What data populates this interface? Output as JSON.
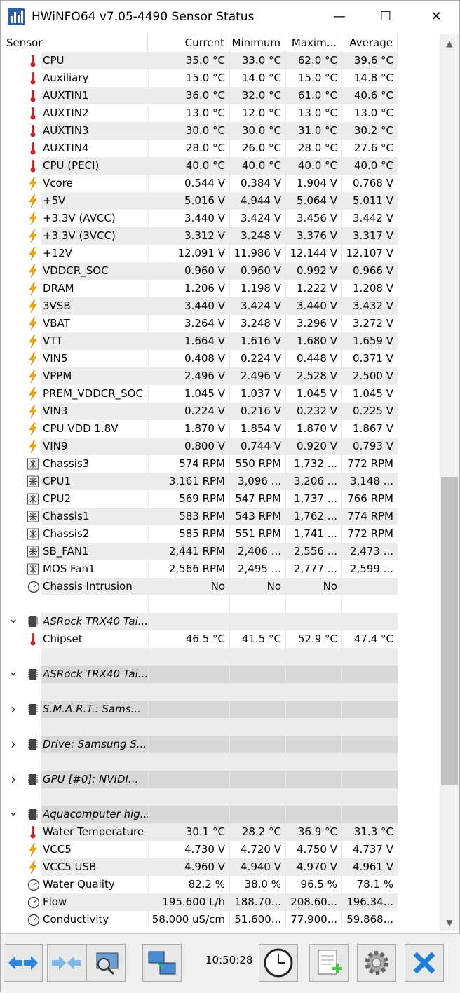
{
  "window": {
    "title": "HWiNFO64 v7.05-4490 Sensor Status",
    "minimize": "—",
    "maximize": "☐",
    "close": "✕"
  },
  "columns": [
    "Sensor",
    "Current",
    "Minimum",
    "Maxim...",
    "Average"
  ],
  "rows": [
    {
      "type": "sensor",
      "icon": "thermometer",
      "name": "CPU",
      "cur": "35.0 °C",
      "min": "33.0 °C",
      "max": "62.0 °C",
      "avg": "39.6 °C"
    },
    {
      "type": "sensor",
      "icon": "thermometer",
      "name": "Auxiliary",
      "cur": "15.0 °C",
      "min": "14.0 °C",
      "max": "15.0 °C",
      "avg": "14.8 °C"
    },
    {
      "type": "sensor",
      "icon": "thermometer",
      "name": "AUXTIN1",
      "cur": "36.0 °C",
      "min": "32.0 °C",
      "max": "61.0 °C",
      "avg": "40.6 °C"
    },
    {
      "type": "sensor",
      "icon": "thermometer",
      "name": "AUXTIN2",
      "cur": "13.0 °C",
      "min": "12.0 °C",
      "max": "13.0 °C",
      "avg": "13.0 °C"
    },
    {
      "type": "sensor",
      "icon": "thermometer",
      "name": "AUXTIN3",
      "cur": "30.0 °C",
      "min": "30.0 °C",
      "max": "31.0 °C",
      "avg": "30.2 °C"
    },
    {
      "type": "sensor",
      "icon": "thermometer",
      "name": "AUXTIN4",
      "cur": "28.0 °C",
      "min": "26.0 °C",
      "max": "28.0 °C",
      "avg": "27.6 °C"
    },
    {
      "type": "sensor",
      "icon": "thermometer",
      "name": "CPU (PECI)",
      "cur": "40.0 °C",
      "min": "40.0 °C",
      "max": "40.0 °C",
      "avg": "40.0 °C"
    },
    {
      "type": "sensor",
      "icon": "bolt",
      "name": "Vcore",
      "cur": "0.544 V",
      "min": "0.384 V",
      "max": "1.904 V",
      "avg": "0.768 V"
    },
    {
      "type": "sensor",
      "icon": "bolt",
      "name": "+5V",
      "cur": "5.016 V",
      "min": "4.944 V",
      "max": "5.064 V",
      "avg": "5.011 V"
    },
    {
      "type": "sensor",
      "icon": "bolt",
      "name": "+3.3V (AVCC)",
      "cur": "3.440 V",
      "min": "3.424 V",
      "max": "3.456 V",
      "avg": "3.442 V"
    },
    {
      "type": "sensor",
      "icon": "bolt",
      "name": "+3.3V (3VCC)",
      "cur": "3.312 V",
      "min": "3.248 V",
      "max": "3.376 V",
      "avg": "3.317 V"
    },
    {
      "type": "sensor",
      "icon": "bolt",
      "name": "+12V",
      "cur": "12.091 V",
      "min": "11.986 V",
      "max": "12.144 V",
      "avg": "12.107 V"
    },
    {
      "type": "sensor",
      "icon": "bolt",
      "name": "VDDCR_SOC",
      "cur": "0.960 V",
      "min": "0.960 V",
      "max": "0.992 V",
      "avg": "0.966 V"
    },
    {
      "type": "sensor",
      "icon": "bolt",
      "name": "DRAM",
      "cur": "1.206 V",
      "min": "1.198 V",
      "max": "1.222 V",
      "avg": "1.208 V"
    },
    {
      "type": "sensor",
      "icon": "bolt",
      "name": "3VSB",
      "cur": "3.440 V",
      "min": "3.424 V",
      "max": "3.440 V",
      "avg": "3.432 V"
    },
    {
      "type": "sensor",
      "icon": "bolt",
      "name": "VBAT",
      "cur": "3.264 V",
      "min": "3.248 V",
      "max": "3.296 V",
      "avg": "3.272 V"
    },
    {
      "type": "sensor",
      "icon": "bolt",
      "name": "VTT",
      "cur": "1.664 V",
      "min": "1.616 V",
      "max": "1.680 V",
      "avg": "1.659 V"
    },
    {
      "type": "sensor",
      "icon": "bolt",
      "name": "VIN5",
      "cur": "0.408 V",
      "min": "0.224 V",
      "max": "0.448 V",
      "avg": "0.371 V"
    },
    {
      "type": "sensor",
      "icon": "bolt",
      "name": "VPPM",
      "cur": "2.496 V",
      "min": "2.496 V",
      "max": "2.528 V",
      "avg": "2.500 V"
    },
    {
      "type": "sensor",
      "icon": "bolt",
      "name": "PREM_VDDCR_SOC",
      "cur": "1.045 V",
      "min": "1.037 V",
      "max": "1.045 V",
      "avg": "1.045 V"
    },
    {
      "type": "sensor",
      "icon": "bolt",
      "name": "VIN3",
      "cur": "0.224 V",
      "min": "0.216 V",
      "max": "0.232 V",
      "avg": "0.225 V"
    },
    {
      "type": "sensor",
      "icon": "bolt",
      "name": "CPU VDD 1.8V",
      "cur": "1.870 V",
      "min": "1.854 V",
      "max": "1.870 V",
      "avg": "1.867 V"
    },
    {
      "type": "sensor",
      "icon": "bolt",
      "name": "VIN9",
      "cur": "0.800 V",
      "min": "0.744 V",
      "max": "0.920 V",
      "avg": "0.793 V"
    },
    {
      "type": "sensor",
      "icon": "fan",
      "name": "Chassis3",
      "cur": "574 RPM",
      "min": "550 RPM",
      "max": "1,732 ...",
      "avg": "772 RPM"
    },
    {
      "type": "sensor",
      "icon": "fan",
      "name": "CPU1",
      "cur": "3,161 RPM",
      "min": "3,096 ...",
      "max": "3,206 ...",
      "avg": "3,148 ..."
    },
    {
      "type": "sensor",
      "icon": "fan",
      "name": "CPU2",
      "cur": "569 RPM",
      "min": "547 RPM",
      "max": "1,737 ...",
      "avg": "766 RPM"
    },
    {
      "type": "sensor",
      "icon": "fan",
      "name": "Chassis1",
      "cur": "583 RPM",
      "min": "543 RPM",
      "max": "1,762 ...",
      "avg": "774 RPM"
    },
    {
      "type": "sensor",
      "icon": "fan",
      "name": "Chassis2",
      "cur": "585 RPM",
      "min": "551 RPM",
      "max": "1,741 ...",
      "avg": "772 RPM"
    },
    {
      "type": "sensor",
      "icon": "fan",
      "name": "SB_FAN1",
      "cur": "2,441 RPM",
      "min": "2,406 ...",
      "max": "2,556 ...",
      "avg": "2,473 ..."
    },
    {
      "type": "sensor",
      "icon": "fan",
      "name": "MOS Fan1",
      "cur": "2,566 RPM",
      "min": "2,495 ...",
      "max": "2,777 ...",
      "avg": "2,599 ..."
    },
    {
      "type": "sensor",
      "icon": "gauge",
      "name": "Chassis Intrusion",
      "cur": "No",
      "min": "No",
      "max": "No",
      "avg": ""
    },
    {
      "type": "blank"
    },
    {
      "type": "group",
      "expanded": true,
      "name": "ASRock TRX40 Tai..."
    },
    {
      "type": "sensor",
      "icon": "thermometer",
      "name": "Chipset",
      "cur": "46.5 °C",
      "min": "41.5 °C",
      "max": "52.9 °C",
      "avg": "47.4 °C"
    },
    {
      "type": "blank"
    },
    {
      "type": "group",
      "expanded": true,
      "name": "ASRock TRX40 Tai..."
    },
    {
      "type": "blank"
    },
    {
      "type": "group",
      "expanded": false,
      "name": "S.M.A.R.T.: Sams..."
    },
    {
      "type": "blank"
    },
    {
      "type": "group",
      "expanded": false,
      "name": "Drive: Samsung S..."
    },
    {
      "type": "blank"
    },
    {
      "type": "group",
      "expanded": false,
      "name": "GPU [#0]: NVIDI..."
    },
    {
      "type": "blank"
    },
    {
      "type": "group",
      "expanded": true,
      "name": "Aquacomputer hig..."
    },
    {
      "type": "sensor",
      "icon": "thermometer",
      "name": "Water Temperature",
      "cur": "30.1 °C",
      "min": "28.2 °C",
      "max": "36.9 °C",
      "avg": "31.3 °C"
    },
    {
      "type": "sensor",
      "icon": "bolt",
      "name": "VCC5",
      "cur": "4.730 V",
      "min": "4.720 V",
      "max": "4.750 V",
      "avg": "4.737 V"
    },
    {
      "type": "sensor",
      "icon": "bolt",
      "name": "VCC5 USB",
      "cur": "4.960 V",
      "min": "4.940 V",
      "max": "4.970 V",
      "avg": "4.961 V"
    },
    {
      "type": "sensor",
      "icon": "gauge",
      "name": "Water Quality",
      "cur": "82.2 %",
      "min": "38.0 %",
      "max": "96.5 %",
      "avg": "78.1 %"
    },
    {
      "type": "sensor",
      "icon": "gauge",
      "name": "Flow",
      "cur": "195.600 L/h",
      "min": "188.70...",
      "max": "208.60...",
      "avg": "196.34..."
    },
    {
      "type": "sensor",
      "icon": "gauge",
      "name": "Conductivity",
      "cur": "58.000 uS/cm",
      "min": "51.600...",
      "max": "77.900...",
      "avg": "59.868..."
    }
  ],
  "toolbar": {
    "time": "10:50:28",
    "buttons": [
      "arrows-left-right-icon",
      "arrows-collapse-icon",
      "network-scan-icon",
      "computers-network-icon",
      "clock-icon",
      "add-report-icon",
      "settings-gear-icon",
      "close-x-icon"
    ]
  },
  "colors": {
    "thermometer": "#c0262b",
    "bolt": "#f5a800",
    "accent": "#2a6fd1",
    "close_x": "#1d7fd8"
  }
}
